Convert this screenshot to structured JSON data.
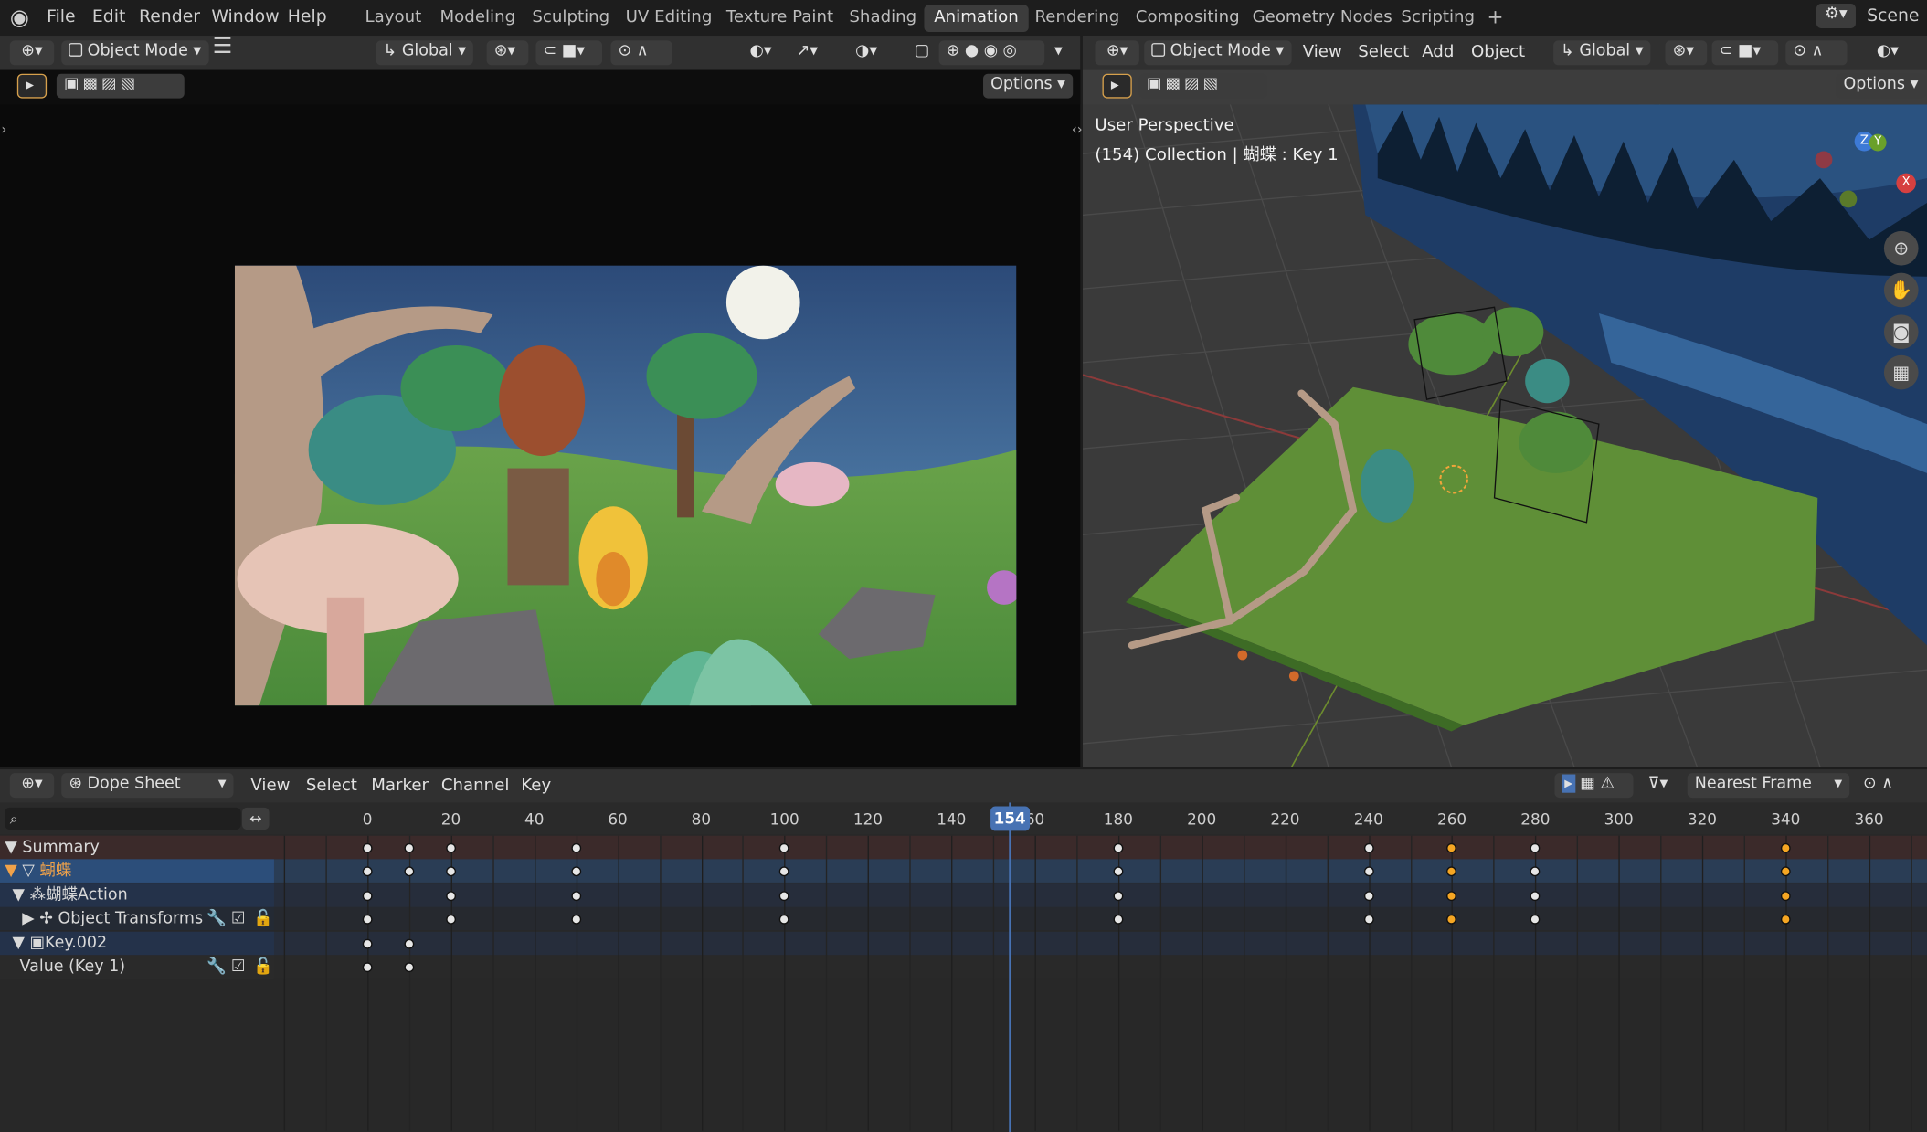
{
  "topbar": {
    "menus": [
      "File",
      "Edit",
      "Render",
      "Window",
      "Help"
    ],
    "workspaces": [
      "Layout",
      "Modeling",
      "Sculpting",
      "UV Editing",
      "Texture Paint",
      "Shading",
      "Animation",
      "Rendering",
      "Compositing",
      "Geometry Nodes",
      "Scripting"
    ],
    "active_workspace": "Animation",
    "add_tab": "+",
    "scene_label": "Scene"
  },
  "camera_view": {
    "mode": "Object Mode",
    "orientation": "Global",
    "options_label": "Options"
  },
  "viewport": {
    "mode": "Object Mode",
    "menus": [
      "View",
      "Select",
      "Add",
      "Object"
    ],
    "orientation": "Global",
    "options_label": "Options",
    "overlay_title": "User Perspective",
    "overlay_info": "(154) Collection | 蝴蝶 : Key 1",
    "gizmo": {
      "x": "X",
      "y": "Y",
      "z": "Z"
    }
  },
  "dopesheet": {
    "editor_mode": "Dope Sheet",
    "menus": [
      "View",
      "Select",
      "Marker",
      "Channel",
      "Key"
    ],
    "snap_mode": "Nearest Frame",
    "current_frame": "154",
    "frame_ticks": [
      "0",
      "20",
      "40",
      "60",
      "80",
      "100",
      "120",
      "140",
      "60",
      "180",
      "200",
      "220",
      "240",
      "260",
      "280",
      "300",
      "320",
      "340",
      "360"
    ],
    "channels": [
      {
        "label": "Summary",
        "kind": "summary"
      },
      {
        "label": "蝴蝶",
        "kind": "object"
      },
      {
        "label": "蝴蝶Action",
        "kind": "action"
      },
      {
        "label": "Object Transforms",
        "kind": "group"
      },
      {
        "label": "Key.002",
        "kind": "shapekey"
      },
      {
        "label": "Value (Key 1)",
        "kind": "fcurve"
      }
    ],
    "keyframes": {
      "summary": [
        0,
        10,
        20,
        50,
        100,
        180,
        240,
        260,
        280,
        340
      ],
      "object": [
        0,
        10,
        20,
        50,
        100,
        180,
        240,
        260,
        280,
        340
      ],
      "action": [
        0,
        20,
        50,
        100,
        180,
        240,
        260,
        280,
        340
      ],
      "group": [
        0,
        20,
        50,
        100,
        180,
        240,
        260,
        280,
        340
      ],
      "shapekey": [
        0,
        10
      ],
      "fcurve": [
        0,
        10
      ]
    },
    "selected_frames": [
      260,
      340
    ]
  },
  "colors": {
    "accent": "#4772b3",
    "selected_key": "#f5a623",
    "summary_row": "#3b2a2a",
    "object_row": "#2c4e7a"
  }
}
